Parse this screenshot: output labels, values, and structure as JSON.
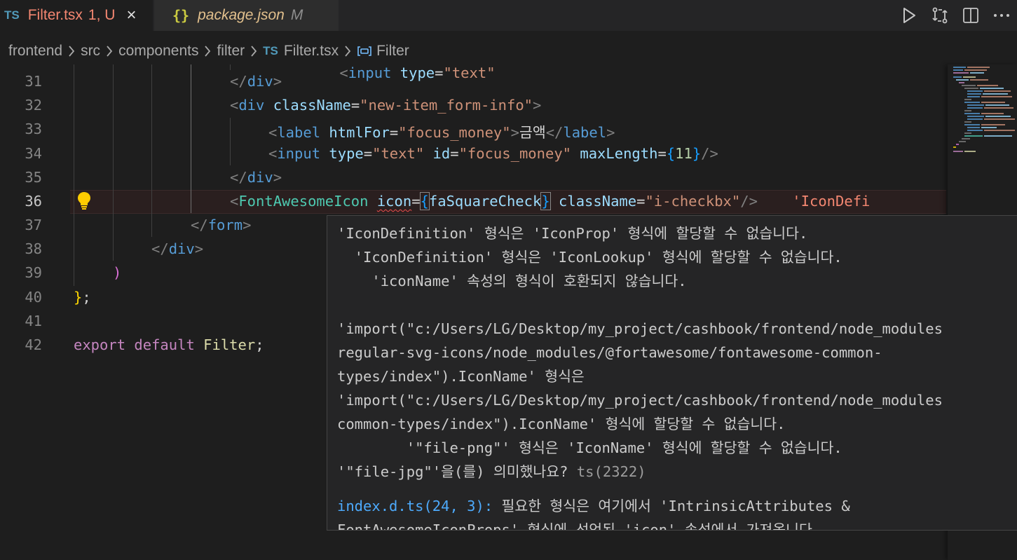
{
  "tabs": [
    {
      "badge": "TS",
      "name": "Filter.tsx",
      "flag": "1, U",
      "close": "×"
    },
    {
      "badge": "{}",
      "name": "package.json",
      "flag": "M"
    }
  ],
  "actions": [
    "run-icon",
    "compare-changes-icon",
    "split-editor-icon",
    "more-actions-icon"
  ],
  "breadcrumb": {
    "items": [
      "frontend",
      "src",
      "components",
      "filter"
    ],
    "file_badge": "TS",
    "file": "Filter.tsx",
    "symbol": "Filter"
  },
  "editor": {
    "line_numbers": [
      "31",
      "32",
      "33",
      "34",
      "35",
      "36",
      "37",
      "38",
      "39",
      "40",
      "41",
      "42"
    ],
    "current_line": "36",
    "lines": {
      "l31": {
        "lt": "</",
        "tag": "div",
        "gt": ">"
      },
      "l32": {
        "lt": "<",
        "tag": "div",
        "attr": "className",
        "eq": "=",
        "val": "\"new-item_form-info\"",
        "gt": ">"
      },
      "l33": {
        "lt": "<",
        "tag": "label",
        "attr": "htmlFor",
        "eq": "=",
        "val": "\"focus_money\"",
        "gt": ">",
        "text": "금액",
        "clt": "</",
        "ctag": "label",
        "cgt": ">"
      },
      "l34": {
        "lt": "<",
        "tag": "input",
        "attr1": "type",
        "eq": "=",
        "val1": "\"text\"",
        "attr2": "id",
        "val2": "\"focus_money\"",
        "attr3": "maxLength",
        "ob": "{",
        "num": "11",
        "cb": "}",
        "end": "/>"
      },
      "l35": {
        "lt": "</",
        "tag": "div",
        "gt": ">"
      },
      "l36": {
        "lt": "<",
        "comp": "FontAwesomeIcon",
        "attr1": "icon",
        "eq": "=",
        "ob": "{",
        "ident": "faSquareCheck",
        "cb": "}",
        "attr2": "className",
        "val2": "\"i-checkbx\"",
        "end": "/>",
        "inline_error": "'IconDefi"
      },
      "l37": {
        "lt": "</",
        "tag": "form",
        "gt": ">"
      },
      "l38": {
        "lt": "</",
        "tag": "div",
        "gt": ">"
      },
      "l39": {
        "paren": ")"
      },
      "l40": {
        "brace": "}",
        "semi": ";"
      },
      "l42": {
        "kw1": "export",
        "kw2": "default",
        "name": "Filter",
        "semi": ";"
      }
    }
  },
  "hover": {
    "lines": [
      "'IconDefinition' 형식은 'IconProp' 형식에 할당할 수 없습니다.",
      "  'IconDefinition' 형식은 'IconLookup' 형식에 할당할 수 없습니다.",
      "    'iconName' 속성의 형식이 호환되지 않습니다.",
      "",
      "'import(\"c:/Users/LG/Desktop/my_project/cashbook/frontend/node_modules",
      "regular-svg-icons/node_modules/@fortawesome/fontawesome-common-",
      "types/index\").IconName' 형식은",
      "'import(\"c:/Users/LG/Desktop/my_project/cashbook/frontend/node_modules",
      "common-types/index\").IconName' 형식에 할당할 수 없습니다.",
      "        '\"file-png\"' 형식은 'IconName' 형식에 할당할 수 없습니다.",
      "'\"file-jpg\"'을(를) 의미했나요?"
    ],
    "ts_code": "ts(2322)",
    "related_ref": "index.d.ts(24, 3):",
    "related_text": " 필요한 형식은 여기에서 'IntrinsicAttributes &",
    "related_cont": "FontAwesomeIconProps' 형식에 선언된 'icon' 속성에서 가져옵니다."
  },
  "colors": {
    "background": "#1e1e1e",
    "error": "#f48771",
    "tag": "#569cd6",
    "attribute": "#9cdcfe",
    "string": "#ce9178",
    "component": "#4ec9b0"
  }
}
